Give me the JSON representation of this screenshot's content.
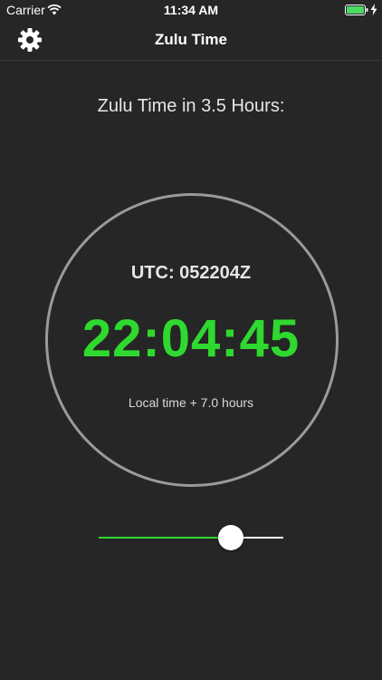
{
  "status_bar": {
    "carrier": "Carrier",
    "time": "11:34 AM",
    "battery_color": "#4cd964"
  },
  "nav": {
    "title": "Zulu Time",
    "settings_icon": "gear-icon"
  },
  "heading": "Zulu Time in 3.5 Hours:",
  "dial": {
    "utc": "UTC: 052204Z",
    "time": "22:04:45",
    "offset_note": "Local time + 7.0 hours",
    "time_color": "#2fd92f",
    "ring_color": "#9a9a9a"
  },
  "slider": {
    "value": 0.75,
    "min_track_color": "#2fd92f",
    "max_track_color": "#ffffff"
  }
}
